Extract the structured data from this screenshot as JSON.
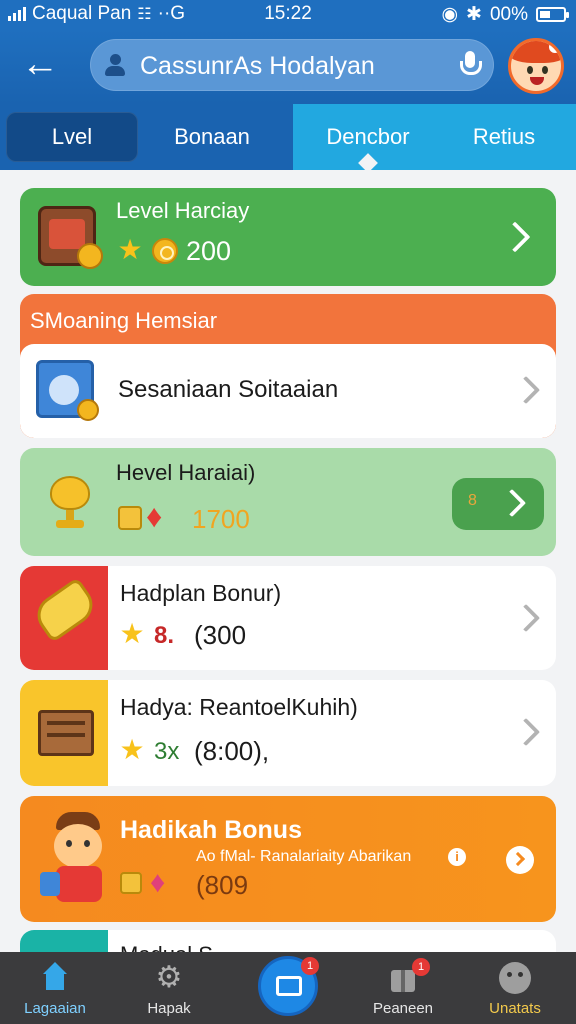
{
  "status": {
    "carrier": "Caqual Pan",
    "network": "G",
    "time": "15:22",
    "battery": "00%"
  },
  "header": {
    "search_text": "CassunrAs Hodalyan"
  },
  "tabs": [
    {
      "label": "Lvel",
      "active": true
    },
    {
      "label": "Bonaan",
      "active": false
    },
    {
      "label": "Dencbor",
      "active": false
    },
    {
      "label": "Retius",
      "active": false
    }
  ],
  "cards": {
    "level": {
      "title": "Level Harciay",
      "value": "200"
    },
    "section": {
      "label": "SMoaning Hemsiar"
    },
    "sesanian": {
      "title": "Sesaniaan Soitaaian"
    },
    "hevel": {
      "title": "Hevel Haraiai)",
      "value": "1700",
      "button_number": "8"
    },
    "hadplan": {
      "title": "Hadplan Bonur)",
      "marker": "8.",
      "value": "(300"
    },
    "hadya": {
      "title": "Hadya: ReantoelKuhih)",
      "marker": "3x",
      "value": "(8:00),",
      "value_suffix": ""
    },
    "hadikah": {
      "title": "Hadikah Bonus",
      "subtitle": "Ao fMal- Ranalariaity Abarikan",
      "value": "(809"
    },
    "partial": {
      "title": "Madual S"
    }
  },
  "nav": [
    {
      "label": "Lagaaian",
      "icon": "home-icon",
      "active": true
    },
    {
      "label": "Hapak",
      "icon": "gear-icon",
      "active": false
    },
    {
      "label": "",
      "icon": "message-icon",
      "badge": "1"
    },
    {
      "label": "Peaneen",
      "icon": "gift-icon",
      "badge": "1"
    },
    {
      "label": "Unatats",
      "icon": "face-icon",
      "active": false
    }
  ],
  "colors": {
    "primary": "#1f6fbf",
    "green": "#4caf50",
    "orange": "#f57c1f",
    "accent_blue": "#22a8e0"
  }
}
